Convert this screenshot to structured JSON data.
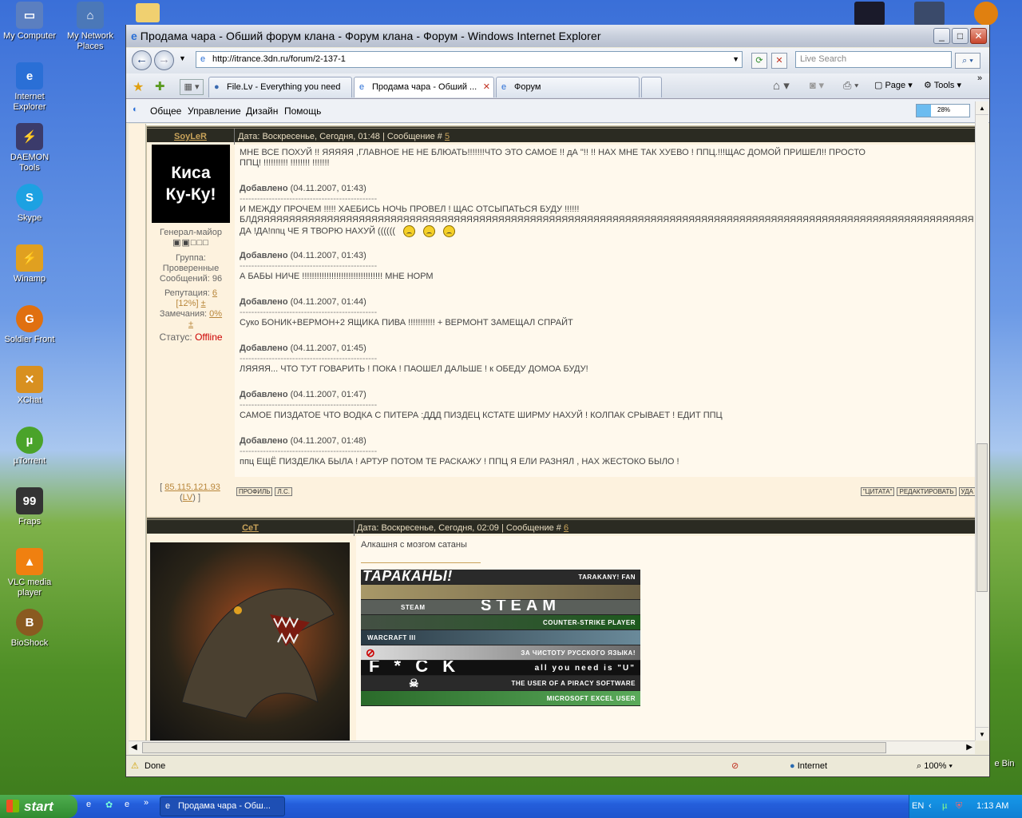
{
  "desktop": {
    "icons": [
      {
        "label": "My Computer",
        "icon": "computer-icon",
        "color": "#5b7fc0"
      },
      {
        "label": "My Network Places",
        "icon": "network-icon",
        "color": "#4b78b8"
      },
      {
        "label": "Internet Explorer",
        "icon": "ie-icon",
        "color": "#2a6fd6"
      },
      {
        "label": "DAEMON Tools",
        "icon": "daemon-tools-icon",
        "color": "#3b3b6b"
      },
      {
        "label": "Skype",
        "icon": "skype-icon",
        "color": "#1da1e2"
      },
      {
        "label": "Winamp",
        "icon": "winamp-icon",
        "color": "#e0a020"
      },
      {
        "label": "Soldier Front",
        "icon": "soldier-front-icon",
        "color": "#e07010"
      },
      {
        "label": "XChat",
        "icon": "xchat-icon",
        "color": "#d89020"
      },
      {
        "label": "µTorrent",
        "icon": "utorrent-icon",
        "color": "#4aa32a"
      },
      {
        "label": "Fraps",
        "icon": "fraps-icon",
        "color": "#333333"
      },
      {
        "label": "VLC media player",
        "icon": "vlc-icon",
        "color": "#f08010"
      },
      {
        "label": "BioShock",
        "icon": "bioshock-icon",
        "color": "#8a5a20"
      }
    ],
    "recycle_label": "e Bin"
  },
  "browser": {
    "title": "Продама чара - Обший форум клана - Форум клана - Форум - Windows Internet Explorer",
    "address": "http://itrance.3dn.ru/forum/2-137-1",
    "search_placeholder": "Live Search",
    "tabs": [
      {
        "label": "File.Lv - Everything you need"
      },
      {
        "label": "Продама чара - Обший ..."
      },
      {
        "label": "Форум"
      }
    ],
    "commands": {
      "page": "Page",
      "tools": "Tools"
    },
    "site_menu": [
      "Общее",
      "Управление",
      "Дизайн",
      "Помощь"
    ],
    "progress": "28%",
    "status": {
      "text": "Done",
      "zone": "Internet",
      "zoom": "100%"
    }
  },
  "posts": [
    {
      "nick": "SoyLeR",
      "meta_prefix": "Дата: Воскресенье, Сегодня, 01:48 | Сообщение # ",
      "num": "5",
      "avatar_text_1": "Киса",
      "avatar_text_2": "Ку-Ку!",
      "rank": "Генерал-майор",
      "group_label": "Группа:",
      "group": "Проверенные",
      "messages": "Сообщений: 96",
      "rep_label": "Репутация:",
      "rep": "6",
      "rep_pct": "[12%]",
      "pm": "±",
      "warn_label": "Замечания:",
      "warn": "0%",
      "status_label": "Статус:",
      "status": "Offline",
      "ip": "85.115.121.93",
      "country": "LV",
      "buttons_left": [
        "ПРОФИЛЬ",
        "Л.С."
      ],
      "buttons_right": [
        "\"ЦИТАТА\"",
        "РЕДАКТИРОВАТЬ",
        "УДА"
      ],
      "lines": {
        "l1": "МНЕ ВСЕ ПОХУЙ !! ЯЯЯЯЯ ,ГЛАВНОЕ НЕ НЕ БЛЮАТЬ!!!!!!!ЧТО ЭТО САМОЕ !! дА \"!! !! НАХ МНЕ ТАК ХУЕВО ! ППЦ.!!!ЩАС ДОМОЙ ПРИШЕЛ!! ПРОСТО",
        "l2": "ППЦ! !!!!!!!!!! !!!!!!!! !!!!!!!",
        "added": "Добавлено",
        "dashes": "-----------------------------------------------",
        "d1": "(04.11.2007, 01:43)",
        "t1a": "И МЕЖДУ ПРОЧЕМ !!!!! ХАЕБИСЬ НОЧЬ ПРОВЕЛ ! ЩАС ОТСЫПАТЬСЯ БУДУ !!!!!!",
        "t1b": "БЛДЯЯЯЯЯЯЯЯЯЯЯЯЯЯЯЯЯЯЯЯЯЯЯЯЯЯЯЯЯЯЯЯЯЯЯЯЯЯЯЯЯЯЯЯЯЯЯЯЯЯЯЯЯЯЯЯЯЯЯЯЯЯЯЯЯЯЯЯЯЯЯЯЯЯЯЯЯЯЯЯЯЯЯЯЯЯЯЯЯЯЯЯЯЯЯЯЯЯЯЯЯЯЯЯЯЯЯЯЯЯЯЯЯЯЯЯЯЯЯЯЯЯЯЯЯЯЯЯЯЯЯЯЯЯЯЯ",
        "t1c": "ДА !ДА!ппц ЧЕ Я ТВОРЮ НАХУЙ ((((((",
        "d2": "(04.11.2007, 01:43)",
        "t2": "А БАБЫ НИЧЕ !!!!!!!!!!!!!!!!!!!!!!!!!!!!!!!!! МНЕ НОРМ",
        "d3": "(04.11.2007, 01:44)",
        "t3": "Суко БОНИК+ВЕРМОН+2 ЯЩИКА ПИВА !!!!!!!!!!! + ВЕРМОНТ ЗАМЕЩАЛ СПРАЙТ",
        "d4": "(04.11.2007, 01:45)",
        "t4": "ЛЯЯЯЯ... ЧТО ТУТ ГОВАРИТЬ ! ПОКА ! ПАОШЕЛ ДАЛЬШЕ ! к ОБЕДУ ДОМОА БУДУ!",
        "d5": "(04.11.2007, 01:47)",
        "t5": "САМОЕ ПИЗДАТОЕ ЧТО ВОДКА С ПИТЕРА :ДДД ПИЗДЕЦ КСТАТЕ ШИРМУ НАХУЙ ! КОЛПАК СРЫВАЕТ ! ЕДИТ ППЦ",
        "d6": "(04.11.2007, 01:48)",
        "t6": "ппц ЕЩЁ ПИЗДЕЛКА БЫЛА ! АРТУР ПОТОМ ТЕ РАСКАЖУ ! ППЦ Я ЕЛИ РАЗНЯЛ , НАХ ЖЕСТОКО БЫЛО !"
      }
    },
    {
      "nick": "CeT",
      "meta_prefix": "Дата: Воскресенье, Сегодня, 02:09 | Сообщение # ",
      "num": "6",
      "text": "Алкашня с мозгом сатаны",
      "banners": [
        {
          "label": "TARAKANY! FAN",
          "big": "ТАРАКАНЫ!",
          "color": "#2a2a2a"
        },
        {
          "label": "",
          "big": "",
          "color": "#7a6b4a"
        },
        {
          "label": "STEAM",
          "big": "STEAM",
          "color": "#5a5f5a"
        },
        {
          "label": "COUNTER-STRIKE PLAYER",
          "big": "",
          "color": "#1e5a1e"
        },
        {
          "label": "WARCRAFT III",
          "big": "",
          "color": "#4c5e6a"
        },
        {
          "label": "ЗА ЧИСТОТУ РУССКОГО ЯЗЫКА!",
          "big": "",
          "color": "#7a7a7a"
        },
        {
          "label": "all you need is \"U\"",
          "big": "F * C K",
          "color": "#111111"
        },
        {
          "label": "THE USER OF A PIRACY SOFTWARE",
          "big": "",
          "color": "#2a2a2a"
        },
        {
          "label": "MICROSOFT EXCEL USER",
          "big": "",
          "color": "#3a8a3a"
        }
      ]
    }
  ],
  "taskbar": {
    "start": "start",
    "task": "Продама чара - Обш...",
    "lang": "EN",
    "clock": "1:13 AM"
  }
}
